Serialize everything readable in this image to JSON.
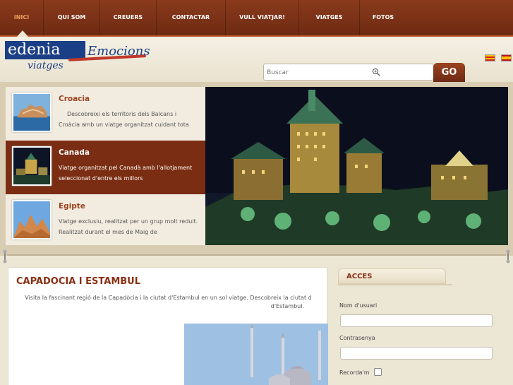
{
  "nav": {
    "items": [
      "INICI",
      "QUI SOM",
      "CREUERS",
      "CONTACTAR",
      "VULL VIATJAR!",
      "VIATGES",
      "FOTOS"
    ]
  },
  "logo": {
    "edenia": "edenia",
    "emocions": "Emocions",
    "viatges": "viatges"
  },
  "search": {
    "placeholder": "Buscar",
    "button": "GO"
  },
  "slider": {
    "items": [
      {
        "title": "Croacia",
        "desc": "Descobreixi els territoris dels Balcans i Croàcia amb un viatge organitzat cuidant tota"
      },
      {
        "title": "Canada",
        "desc": "Viatge organitzat pel Canadà amb l'allotjament seleccionat d'entre els millors"
      },
      {
        "title": "Egipte",
        "desc": "Viatge exclusiu, realitzat per un grup molt reduit. Realitzat durant el mes de Maig de"
      }
    ]
  },
  "article": {
    "title": "CAPADOCIA I ESTAMBUL",
    "intro_line1": "Visita la fascinant regió de la Capadòcia i la ciutat d'Estambul en un sol viatge. Descobreix la ciutat d",
    "intro_line2": "d'Estambul."
  },
  "login": {
    "heading": "ACCES",
    "username_label": "Nom d'usuari",
    "password_label": "Contrasenya",
    "remember_label": "Recorda'm"
  },
  "colors": {
    "nav_bg": "#7a2d12",
    "accent": "#9b4320",
    "brand_blue": "#1b3f86"
  }
}
